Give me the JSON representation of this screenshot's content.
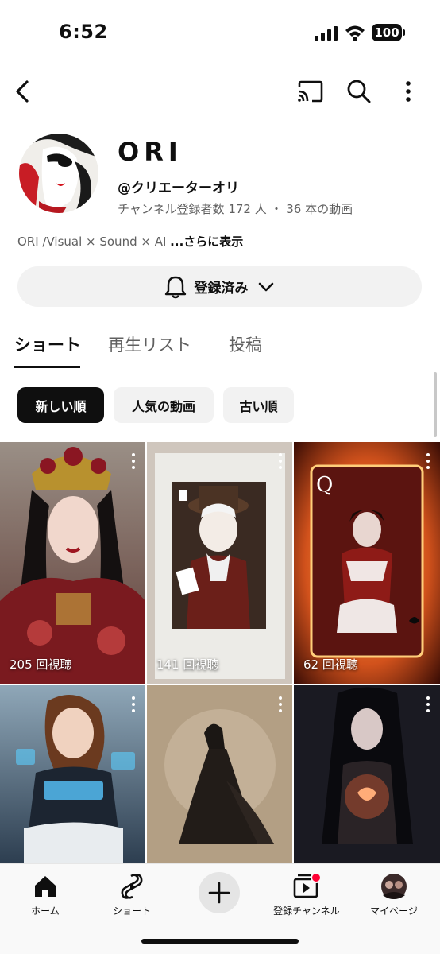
{
  "status_bar": {
    "time": "6:52",
    "battery": "100"
  },
  "channel": {
    "name": "ORI",
    "handle": "@クリエーターオリ",
    "stats": "チャンネル登録者数 172 人 ・ 36 本の動画",
    "description": "ORI /Visual × Sound × AI",
    "more_label": "...さらに表示"
  },
  "subscribe": {
    "label": "登録済み"
  },
  "tabs": [
    {
      "label": "ショート",
      "active": true
    },
    {
      "label": "再生リスト",
      "active": false
    },
    {
      "label": "投稿",
      "active": false
    }
  ],
  "chips": [
    {
      "label": "新しい順",
      "active": true
    },
    {
      "label": "人気の動画",
      "active": false
    },
    {
      "label": "古い順",
      "active": false
    }
  ],
  "shorts": [
    {
      "views": "205 回視聴"
    },
    {
      "views": "141 回視聴"
    },
    {
      "views": "62 回視聴"
    },
    {
      "views": ""
    },
    {
      "views": ""
    },
    {
      "views": ""
    }
  ],
  "bottom_nav": [
    {
      "label": "ホーム",
      "icon": "home-icon"
    },
    {
      "label": "ショート",
      "icon": "shorts-icon"
    },
    {
      "label": "",
      "icon": "create-icon"
    },
    {
      "label": "登録チャンネル",
      "icon": "subscriptions-icon"
    },
    {
      "label": "マイページ",
      "icon": "account-avatar"
    }
  ],
  "colors": {
    "text": "#0f0f0f",
    "secondary": "#606060",
    "chip_bg": "#f2f2f2",
    "notify_dot": "#ff0033"
  }
}
